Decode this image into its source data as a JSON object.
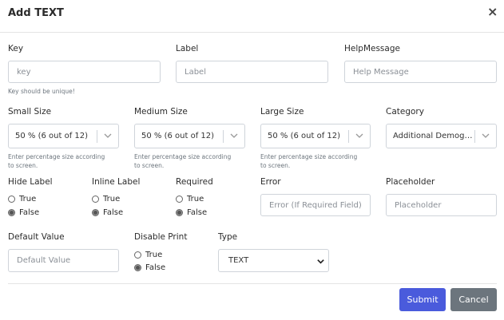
{
  "modal": {
    "title": "Add TEXT",
    "close_glyph": "×"
  },
  "fields": {
    "key": {
      "label": "Key",
      "placeholder": "key",
      "help": "Key should be unique!"
    },
    "label": {
      "label": "Label",
      "placeholder": "Label"
    },
    "help_message": {
      "label": "HelpMessage",
      "placeholder": "Help Message"
    },
    "small_size": {
      "label": "Small Size",
      "value": "50 % (6 out of 12)",
      "help": [
        "Enter percentage size according",
        "to screen."
      ]
    },
    "medium_size": {
      "label": "Medium Size",
      "value": "50 % (6 out of 12)",
      "help": [
        "Enter percentage size according",
        "to screen."
      ]
    },
    "large_size": {
      "label": "Large Size",
      "value": "50 % (6 out of 12)",
      "help": [
        "Enter percentage size according",
        "to screen."
      ]
    },
    "category": {
      "label": "Category",
      "value": "Additional Demographics"
    },
    "hide_label": {
      "label": "Hide Label",
      "options": [
        "True",
        "False"
      ],
      "selected": "False"
    },
    "inline_label": {
      "label": "Inline Label",
      "options": [
        "True",
        "False"
      ],
      "selected": "False"
    },
    "required": {
      "label": "Required",
      "options": [
        "True",
        "False"
      ],
      "selected": "False"
    },
    "error": {
      "label": "Error",
      "placeholder": "Error (If Required Field)"
    },
    "placeholder": {
      "label": "Placeholder",
      "placeholder": "Placeholder"
    },
    "default_value": {
      "label": "Default Value",
      "placeholder": "Default Value"
    },
    "disable_print": {
      "label": "Disable Print",
      "options": [
        "True",
        "False"
      ],
      "selected": "False"
    },
    "type": {
      "label": "Type",
      "value": "TEXT"
    }
  },
  "footer": {
    "submit_label": "Submit",
    "cancel_label": "Cancel"
  },
  "colors": {
    "submit_bg": "#4a5bdc",
    "cancel_bg": "#6c757d"
  }
}
